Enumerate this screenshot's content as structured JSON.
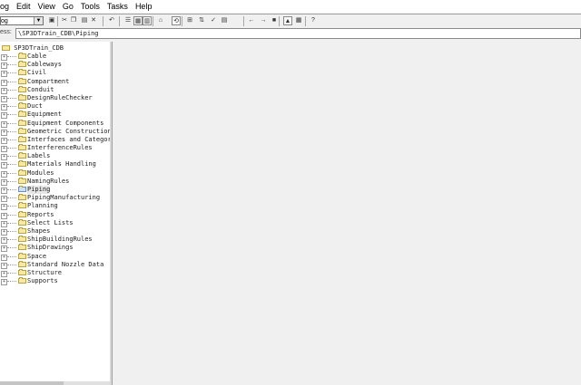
{
  "menu": [
    "og",
    "Edit",
    "View",
    "Go",
    "Tools",
    "Tasks",
    "Help"
  ],
  "toolbar": {
    "combo_value": "og",
    "buttons": [
      {
        "name": "save-icon",
        "glyph": "▣"
      },
      {
        "name": "cut-icon",
        "glyph": "✂"
      },
      {
        "name": "copy-icon",
        "glyph": "❐"
      },
      {
        "name": "paste-icon",
        "glyph": "▤"
      },
      {
        "name": "delete-icon",
        "glyph": "✕"
      },
      {
        "name": "undo-icon",
        "glyph": "↶"
      },
      {
        "name": "view-list-icon",
        "glyph": "☰"
      },
      {
        "name": "view-details-icon",
        "glyph": "▦"
      },
      {
        "name": "view-grid-icon",
        "glyph": "▥"
      },
      {
        "name": "properties-icon",
        "glyph": "⌂"
      },
      {
        "name": "refresh-icon",
        "glyph": "⟲"
      },
      {
        "name": "filter-icon",
        "glyph": "⊞"
      },
      {
        "name": "sort-icon",
        "glyph": "⇅"
      },
      {
        "name": "check-icon",
        "glyph": "✓"
      },
      {
        "name": "tag-icon",
        "glyph": "▤"
      },
      {
        "name": "back-arrow-icon",
        "glyph": "←"
      },
      {
        "name": "forward-arrow-icon",
        "glyph": "→"
      },
      {
        "name": "lock-icon",
        "glyph": "■"
      },
      {
        "name": "folder-up-icon",
        "glyph": "▲"
      },
      {
        "name": "info-icon",
        "glyph": "▦"
      },
      {
        "name": "help-icon",
        "glyph": "?"
      }
    ]
  },
  "address": {
    "label": "ess:",
    "value": "\\SP3DTrain_CDB\\Piping"
  },
  "tree": {
    "root": "SP3DTrain_CDB",
    "items": [
      "Cable",
      "Cableways",
      "Civil",
      "Compartment",
      "Conduit",
      "DesignRuleChecker",
      "Duct",
      "Equipment",
      "Equipment Components",
      "Geometric Construction",
      "Interfaces and Categor",
      "InterferenceRules",
      "Labels",
      "Materials Handling",
      "Modules",
      "NamingRules",
      "Piping",
      "PipingManufacturing",
      "Planning",
      "Reports",
      "Select Lists",
      "Shapes",
      "ShipBuildingRules",
      "ShipDrawings",
      "Space",
      "Standard Nozzle Data",
      "Structure",
      "Supports"
    ],
    "selected": "Piping",
    "expander_glyph": "+"
  },
  "colors": {
    "folder": "#f6e9a4",
    "selection": "#e6e6e6"
  }
}
